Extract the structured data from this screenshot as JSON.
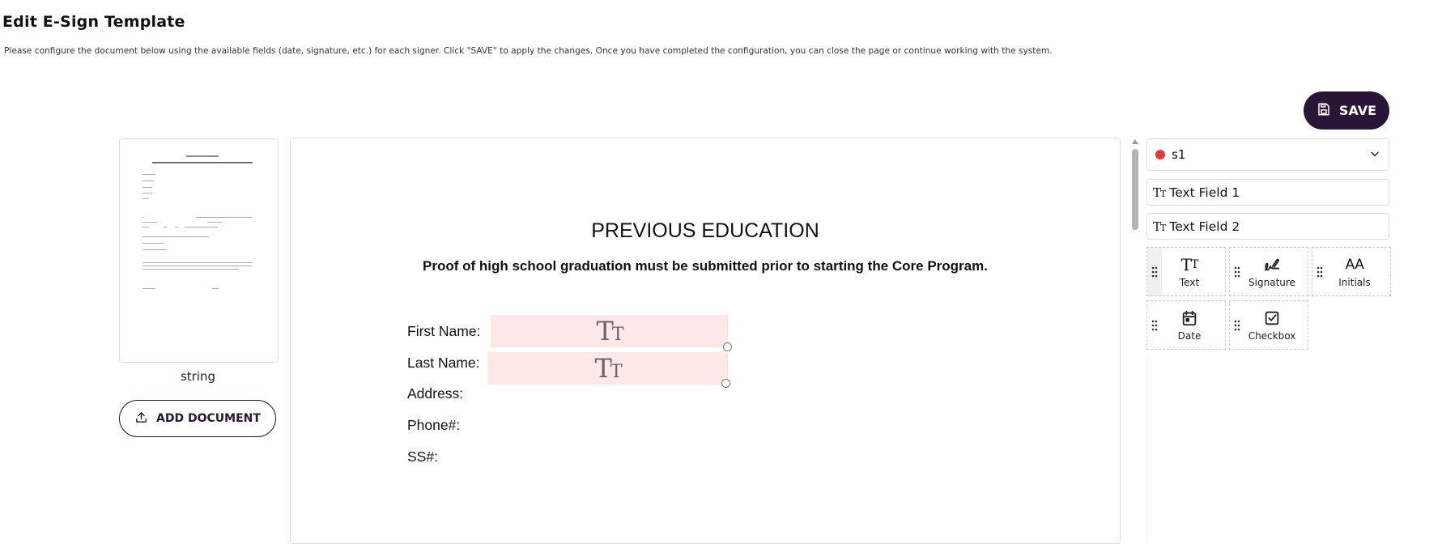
{
  "page": {
    "title": "Edit E-Sign Template",
    "instructions": "Please configure the document below using the available fields (date, signature, etc.) for each signer. Click \"SAVE\" to apply the changes. Once you have completed the configuration, you can close the page or continue working with the system."
  },
  "toolbar": {
    "save_label": "SAVE"
  },
  "documents": {
    "thumbnail_caption": "string",
    "add_document_label": "ADD DOCUMENT"
  },
  "document": {
    "title": "PREVIOUS EDUCATION",
    "subtitle": "Proof of high school graduation must be submitted prior to starting the Core Program.",
    "field_labels": [
      "First Name:",
      "Last Name:",
      "Address:",
      "Phone#:",
      "SS#:"
    ]
  },
  "signer": {
    "name": "s1",
    "color": "#e53935"
  },
  "placed_fields": [
    "Text Field 1",
    "Text Field 2"
  ],
  "tools": [
    {
      "label": "Text",
      "icon": "text-icon"
    },
    {
      "label": "Signature",
      "icon": "signature-icon"
    },
    {
      "label": "Initials",
      "icon": "initials-icon"
    },
    {
      "label": "Date",
      "icon": "calendar-icon"
    },
    {
      "label": "Checkbox",
      "icon": "checkbox-icon"
    }
  ],
  "icons": {
    "initials_glyph": "AA"
  },
  "colors": {
    "accent": "#2a1536",
    "field_fill": "#fde7e7"
  }
}
